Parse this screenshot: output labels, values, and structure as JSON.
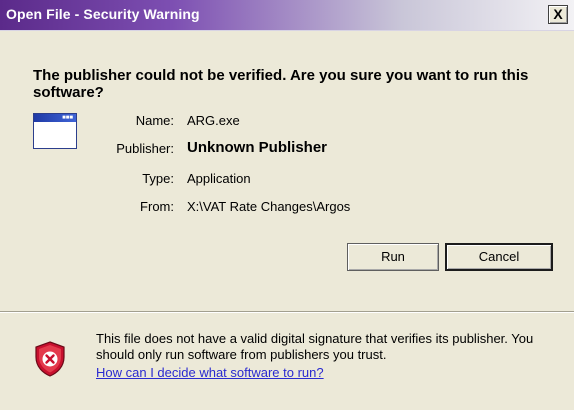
{
  "window": {
    "title": "Open File - Security Warning",
    "close_glyph": "X"
  },
  "question": "The publisher could not be verified.  Are you sure you want to run this software?",
  "file_icon": "application-window-icon",
  "details": {
    "name": {
      "label": "Name:",
      "value": "ARG.exe"
    },
    "publisher": {
      "label": "Publisher:",
      "value": "Unknown Publisher"
    },
    "type": {
      "label": "Type:",
      "value": "Application"
    },
    "from": {
      "label": "From:",
      "value": "X:\\VAT Rate Changes\\Argos"
    }
  },
  "buttons": {
    "run": "Run",
    "cancel": "Cancel"
  },
  "footer": {
    "icon": "shield-warning-icon",
    "warning_text": "This file does not have a valid digital signature that verifies its publisher.  You should only run software from publishers you trust.",
    "help_link": "How can I decide what software to run?"
  },
  "colors": {
    "titlebar_start": "#5b2a8a",
    "titlebar_end": "#f3f2f5",
    "dialog_bg": "#ece9d8",
    "link": "#2a2ad0",
    "shield_red": "#c8102e"
  }
}
